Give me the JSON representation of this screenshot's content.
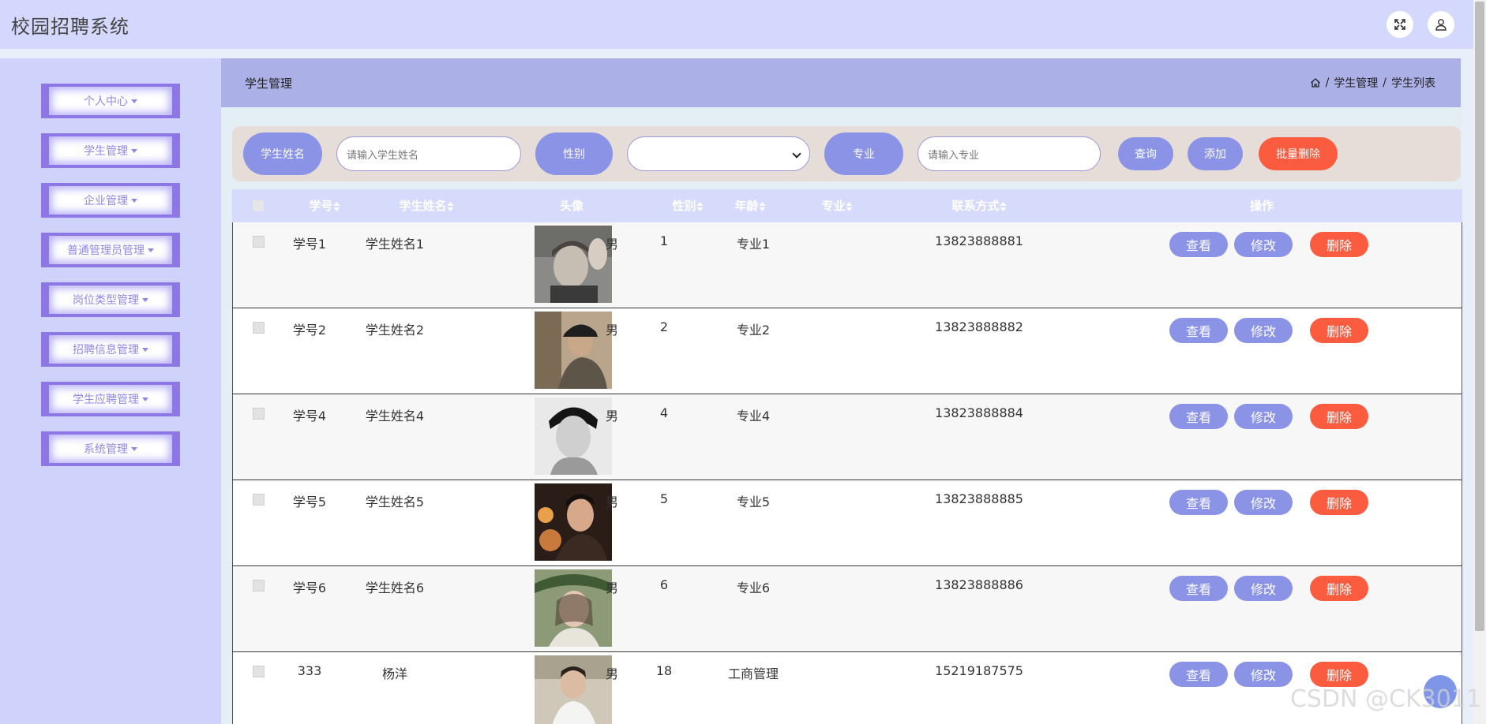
{
  "app": {
    "title": "校园招聘系统"
  },
  "sidebar": {
    "items": [
      {
        "label": "个人中心"
      },
      {
        "label": "学生管理"
      },
      {
        "label": "企业管理"
      },
      {
        "label": "普通管理员管理"
      },
      {
        "label": "岗位类型管理"
      },
      {
        "label": "招聘信息管理"
      },
      {
        "label": "学生应聘管理"
      },
      {
        "label": "系统管理"
      }
    ]
  },
  "header": {
    "title": "学生管理",
    "breadcrumb": [
      "学生管理",
      "学生列表"
    ],
    "separator": "/"
  },
  "search": {
    "name_label": "学生姓名",
    "name_placeholder": "请输入学生姓名",
    "gender_label": "性别",
    "gender_value": "",
    "major_label": "专业",
    "major_placeholder": "请输入专业",
    "query_label": "查询",
    "add_label": "添加",
    "batch_delete_label": "批量删除"
  },
  "table": {
    "columns": [
      "学号",
      "学生姓名",
      "头像",
      "性别",
      "年龄",
      "专业",
      "联系方式",
      "操作"
    ],
    "actions": {
      "view": "查看",
      "edit": "修改",
      "delete": "删除"
    },
    "rows": [
      {
        "id": "学号1",
        "name": "学生姓名1",
        "gender": "男",
        "age": "1",
        "major": "专业1",
        "phone": "13823888881"
      },
      {
        "id": "学号2",
        "name": "学生姓名2",
        "gender": "男",
        "age": "2",
        "major": "专业2",
        "phone": "13823888882"
      },
      {
        "id": "学号4",
        "name": "学生姓名4",
        "gender": "男",
        "age": "4",
        "major": "专业4",
        "phone": "13823888884"
      },
      {
        "id": "学号5",
        "name": "学生姓名5",
        "gender": "男",
        "age": "5",
        "major": "专业5",
        "phone": "13823888885"
      },
      {
        "id": "学号6",
        "name": "学生姓名6",
        "gender": "男",
        "age": "6",
        "major": "专业6",
        "phone": "13823888886"
      },
      {
        "id": "333",
        "name": "杨洋",
        "gender": "男",
        "age": "18",
        "major": "工商管理",
        "phone": "15219187575"
      }
    ]
  },
  "watermark": "CSDN @CK3011",
  "icons": {
    "fullscreen": "expand-icon",
    "user": "user-icon",
    "home": "home-icon"
  }
}
